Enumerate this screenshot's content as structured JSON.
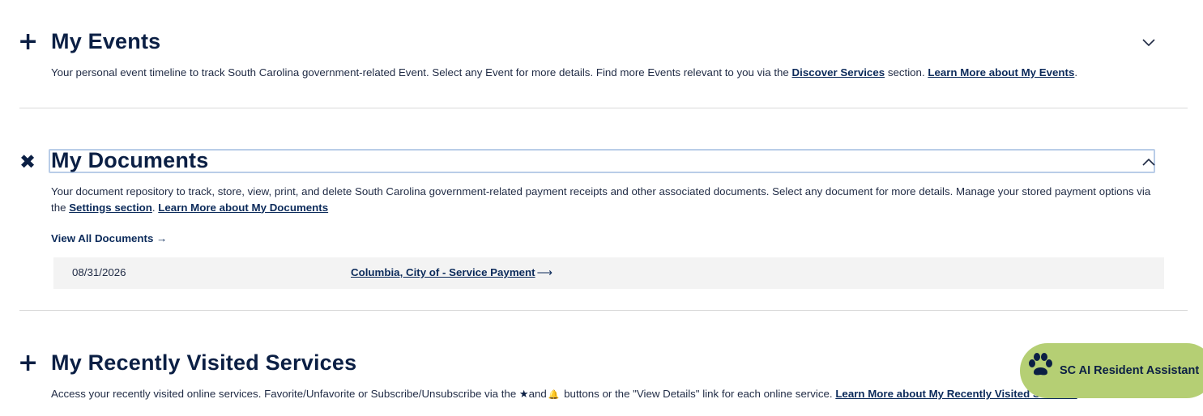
{
  "events": {
    "toggle_glyph": "+",
    "title": "My Events",
    "desc_text": "Your personal event timeline to track South Carolina government-related Event. Select any Event for more details. Find more Events relevant to you via the ",
    "discover_link": "Discover Services",
    "desc_mid": " section. ",
    "learn_link": "Learn More about My Events",
    "desc_end": "."
  },
  "documents": {
    "toggle_glyph": "✖",
    "title": "My Documents",
    "desc_text": "Your document repository to track, store, view, print, and delete South Carolina government-related payment receipts and other associated documents. Select any document for more details. Manage your stored payment options via the ",
    "settings_link": "Settings section",
    "desc_mid": ". ",
    "learn_link": "Learn More about My Documents",
    "view_all": "View All Documents →",
    "rows": [
      {
        "date": "08/31/2026",
        "link": "Columbia, City of - Service Payment",
        "arrow": "⟶"
      }
    ]
  },
  "recent": {
    "toggle_glyph": "+",
    "title": "My Recently Visited Services",
    "desc_text": "Access your recently visited online services. Favorite/Unfavorite or Subscribe/Unsubscribe via the ",
    "star_glyph": "★",
    "and_text": "and",
    "bell_glyph": "🔔",
    "desc_mid": " buttons or the \"View Details\" link for each online service. ",
    "learn_link": "Learn More about My Recently Visited Services"
  },
  "assistant": {
    "label": "SC AI Resident Assistant",
    "icon": "paw-icon",
    "bg_color": "#b5cf74"
  },
  "colors": {
    "heading": "#0b1f44",
    "link": "#0b2a5a",
    "row_bg": "#f3f3f3",
    "focus_border": "#b9cde8"
  }
}
